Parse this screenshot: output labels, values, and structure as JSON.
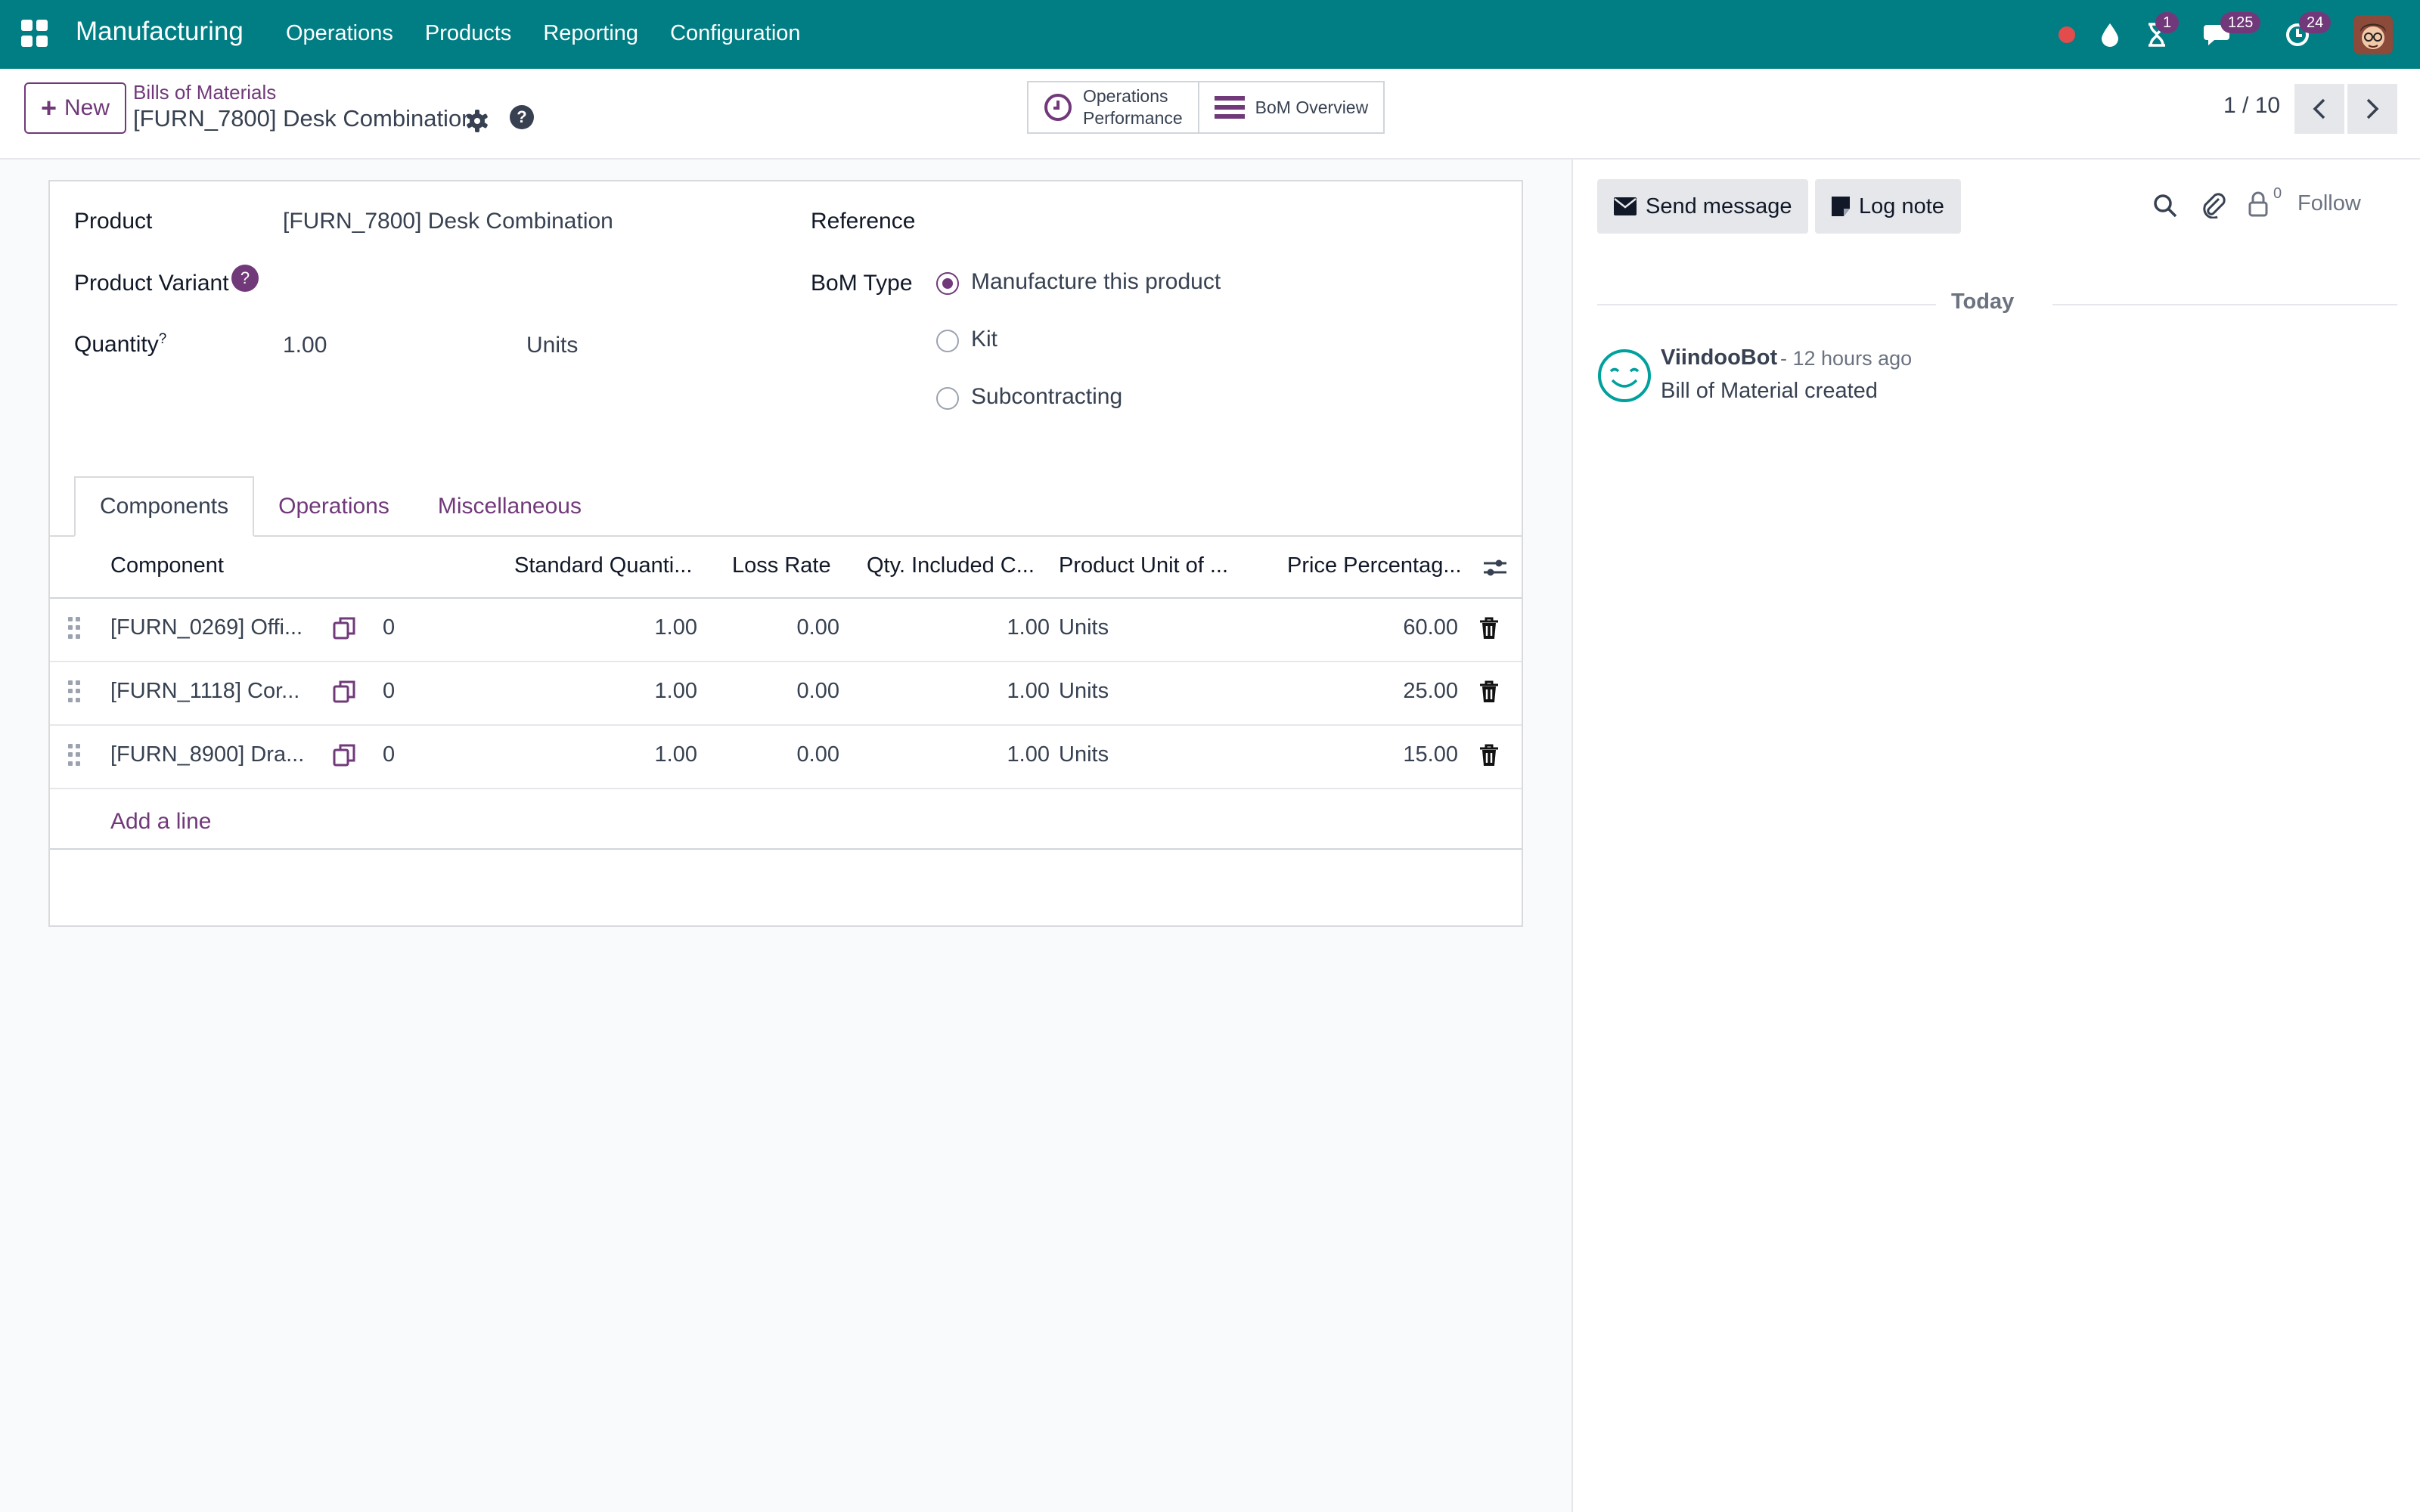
{
  "navbar": {
    "app_name": "Manufacturing",
    "menu": [
      "Operations",
      "Products",
      "Reporting",
      "Configuration"
    ],
    "activity_count": "1",
    "messages_count": "125",
    "updates_count": "24"
  },
  "control_panel": {
    "new_label": "New",
    "breadcrumb": "Bills of Materials",
    "record_title": "[FURN_7800] Desk Combination",
    "smart_buttons": {
      "operations_performance_line1": "Operations",
      "operations_performance_line2": "Performance",
      "bom_overview": "BoM Overview"
    },
    "pager": "1 / 10"
  },
  "form": {
    "product_label": "Product",
    "product_value": "[FURN_7800] Desk Combination",
    "variant_label": "Product Variant",
    "quantity_label": "Quantity",
    "quantity_sup": "?",
    "quantity_value": "1.00",
    "quantity_uom": "Units",
    "reference_label": "Reference",
    "bom_type_label": "BoM Type",
    "bom_type_options": [
      "Manufacture this product",
      "Kit",
      "Subcontracting"
    ],
    "bom_type_selected": "Manufacture this product"
  },
  "tabs": [
    "Components",
    "Operations",
    "Miscellaneous"
  ],
  "table": {
    "headers": [
      "Component",
      "Standard Quanti...",
      "Loss Rate",
      "Qty. Included C...",
      "Product Unit of ...",
      "Price Percentag..."
    ],
    "rows": [
      {
        "component": "[FURN_0269] Offi...",
        "variant_count": "0",
        "std_qty": "1.00",
        "loss_rate": "0.00",
        "qty_included": "1.00",
        "uom": "Units",
        "price_pct": "60.00"
      },
      {
        "component": "[FURN_1118] Cor...",
        "variant_count": "0",
        "std_qty": "1.00",
        "loss_rate": "0.00",
        "qty_included": "1.00",
        "uom": "Units",
        "price_pct": "25.00"
      },
      {
        "component": "[FURN_8900] Dra...",
        "variant_count": "0",
        "std_qty": "1.00",
        "loss_rate": "0.00",
        "qty_included": "1.00",
        "uom": "Units",
        "price_pct": "15.00"
      }
    ],
    "add_line": "Add a line"
  },
  "chatter": {
    "send_message": "Send message",
    "log_note": "Log note",
    "follower_count": "0",
    "follow": "Follow",
    "date_separator": "Today",
    "message": {
      "author": "ViindooBot",
      "time": "- 12 hours ago",
      "body": "Bill of Material created"
    }
  },
  "colors": {
    "navbar": "#017e84",
    "accent": "#71397a",
    "bot_icon": "#00a09d"
  }
}
